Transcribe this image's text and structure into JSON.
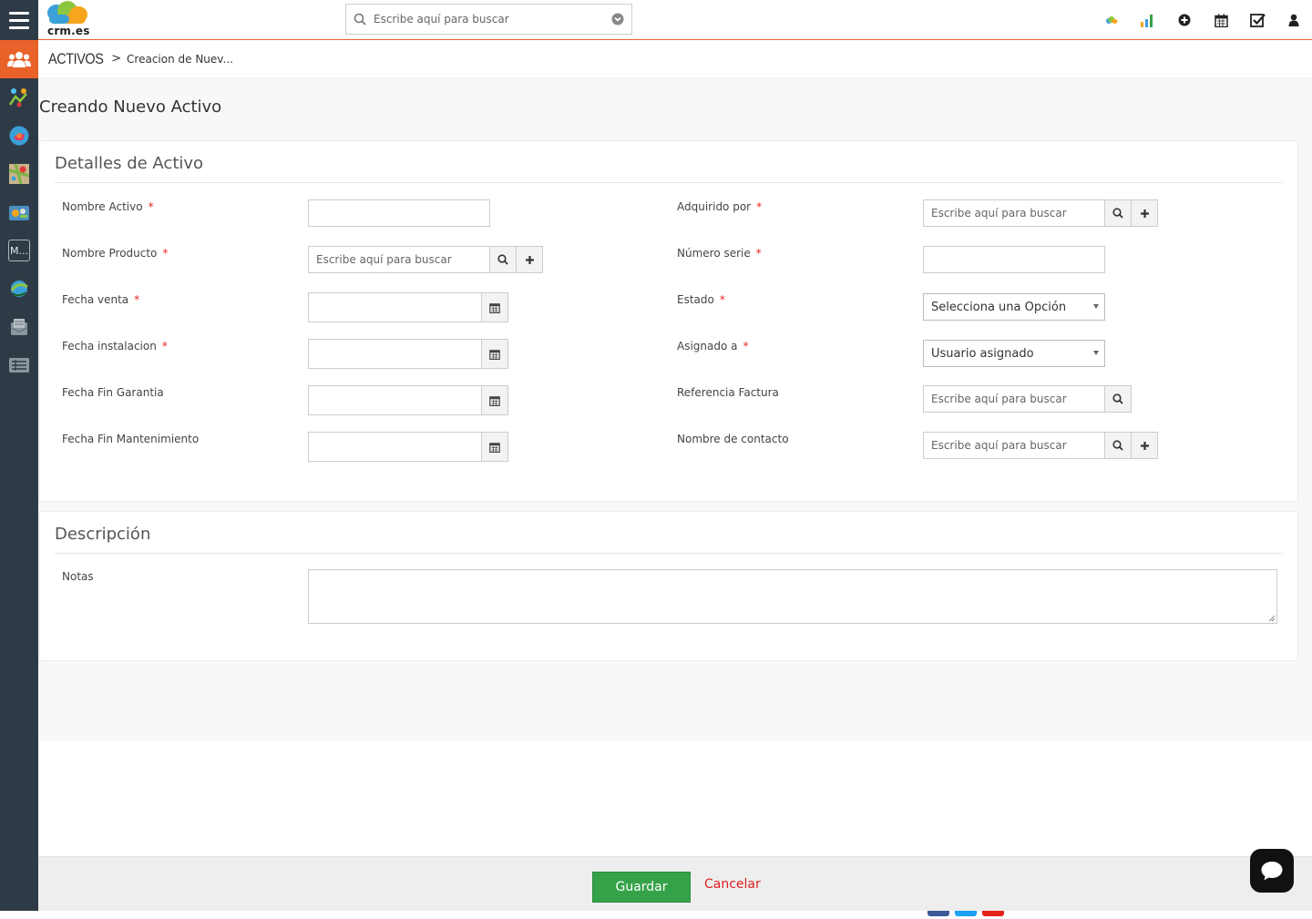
{
  "header": {
    "logo_text": "crm.es",
    "search_placeholder": "Escribe aquí para buscar"
  },
  "top_icons": [
    "cloud-icon",
    "chart-icon",
    "add-icon",
    "calendar-icon",
    "tasks-icon",
    "user-icon"
  ],
  "sidebar": {
    "items": [
      {
        "icon": "users-icon",
        "active": true
      },
      {
        "icon": "marketing-icon"
      },
      {
        "icon": "sales-icon"
      },
      {
        "icon": "map-icon"
      },
      {
        "icon": "inventory-icon"
      },
      {
        "icon": "m-icon",
        "label": "M..."
      },
      {
        "icon": "globe-icon"
      },
      {
        "icon": "support-icon"
      },
      {
        "icon": "list-icon"
      }
    ]
  },
  "breadcrumb": {
    "module": "ACTIVOS",
    "separator": ">",
    "current": "Creacion de Nuev..."
  },
  "page_title": "Creando Nuevo Activo",
  "details_block": {
    "title": "Detalles de Activo",
    "fields": {
      "nombre_activo": {
        "label": "Nombre Activo",
        "required": "*"
      },
      "nombre_producto": {
        "label": "Nombre Producto",
        "required": "*",
        "placeholder": "Escribe aquí para buscar"
      },
      "fecha_venta": {
        "label": "Fecha venta",
        "required": "*"
      },
      "fecha_instalacion": {
        "label": "Fecha instalacion",
        "required": "*"
      },
      "fecha_fin_garantia": {
        "label": "Fecha Fin Garantia"
      },
      "fecha_fin_mantenimiento": {
        "label": "Fecha Fin Mantenimiento"
      },
      "adquirido_por": {
        "label": "Adquirido por",
        "required": "*",
        "placeholder": "Escribe aquí para buscar"
      },
      "numero_serie": {
        "label": "Número serie",
        "required": "*"
      },
      "estado": {
        "label": "Estado",
        "required": "*",
        "value": "Selecciona una Opción"
      },
      "asignado_a": {
        "label": "Asignado a",
        "required": "*",
        "value": "Usuario asignado"
      },
      "referencia_factura": {
        "label": "Referencia Factura",
        "placeholder": "Escribe aquí para buscar"
      },
      "nombre_contacto": {
        "label": "Nombre de contacto",
        "placeholder": "Escribe aquí para buscar"
      }
    }
  },
  "description_block": {
    "title": "Descripción",
    "notas_label": "Notas"
  },
  "footer": {
    "save_label": "Guardar",
    "cancel_label": "Cancelar"
  },
  "colors": {
    "accent": "#e8622a",
    "sidebar": "#2e3b47",
    "save": "#35a24a",
    "cancel": "#e01e1e",
    "required": "#ee2222"
  }
}
